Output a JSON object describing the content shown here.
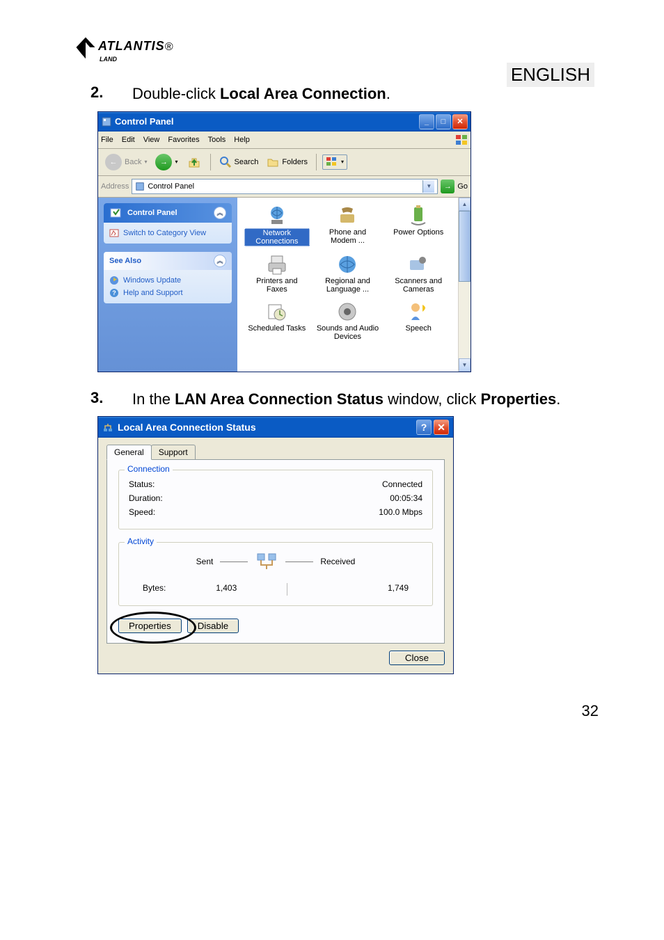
{
  "header": {
    "logo": "ATLANTIS",
    "logo_sub": "LAND",
    "logo_reg": "®",
    "lang_tag": "ENGLISH"
  },
  "step2": {
    "num": "2.",
    "text_pre": "Double-click ",
    "text_bold": "Local Area Connection",
    "text_post": "."
  },
  "cp_window": {
    "title": "Control Panel",
    "menus": [
      "File",
      "Edit",
      "View",
      "Favorites",
      "Tools",
      "Help"
    ],
    "toolbar": {
      "back": "Back",
      "search": "Search",
      "folders": "Folders"
    },
    "address_label": "Address",
    "address_value": "Control Panel",
    "go": "Go",
    "sidebar": {
      "panel1_title": "Control Panel",
      "panel1_link": "Switch to Category View",
      "panel2_title": "See Also",
      "panel2_links": [
        "Windows Update",
        "Help and Support"
      ]
    },
    "icons": [
      {
        "label": "Network Connections",
        "selected": true
      },
      {
        "label": "Phone and Modem ..."
      },
      {
        "label": "Power Options"
      },
      {
        "label": "Printers and Faxes"
      },
      {
        "label": "Regional and Language ..."
      },
      {
        "label": "Scanners and Cameras"
      },
      {
        "label": "Scheduled Tasks"
      },
      {
        "label": "Sounds and Audio Devices"
      },
      {
        "label": "Speech"
      }
    ]
  },
  "step3": {
    "num": "3.",
    "text_a": "In the ",
    "text_bold1": "LAN Area Connection Status",
    "text_b": " window, click ",
    "text_bold2": "Properties",
    "text_c": "."
  },
  "lac_dialog": {
    "title": "Local Area Connection Status",
    "tabs": {
      "general": "General",
      "support": "Support"
    },
    "connection": {
      "legend": "Connection",
      "status_label": "Status:",
      "status_value": "Connected",
      "duration_label": "Duration:",
      "duration_value": "00:05:34",
      "speed_label": "Speed:",
      "speed_value": "100.0 Mbps"
    },
    "activity": {
      "legend": "Activity",
      "sent": "Sent",
      "received": "Received",
      "bytes_label": "Bytes:",
      "bytes_sent": "1,403",
      "bytes_recv": "1,749"
    },
    "buttons": {
      "properties": "Properties",
      "disable": "Disable",
      "close": "Close"
    }
  },
  "page_number": "32"
}
